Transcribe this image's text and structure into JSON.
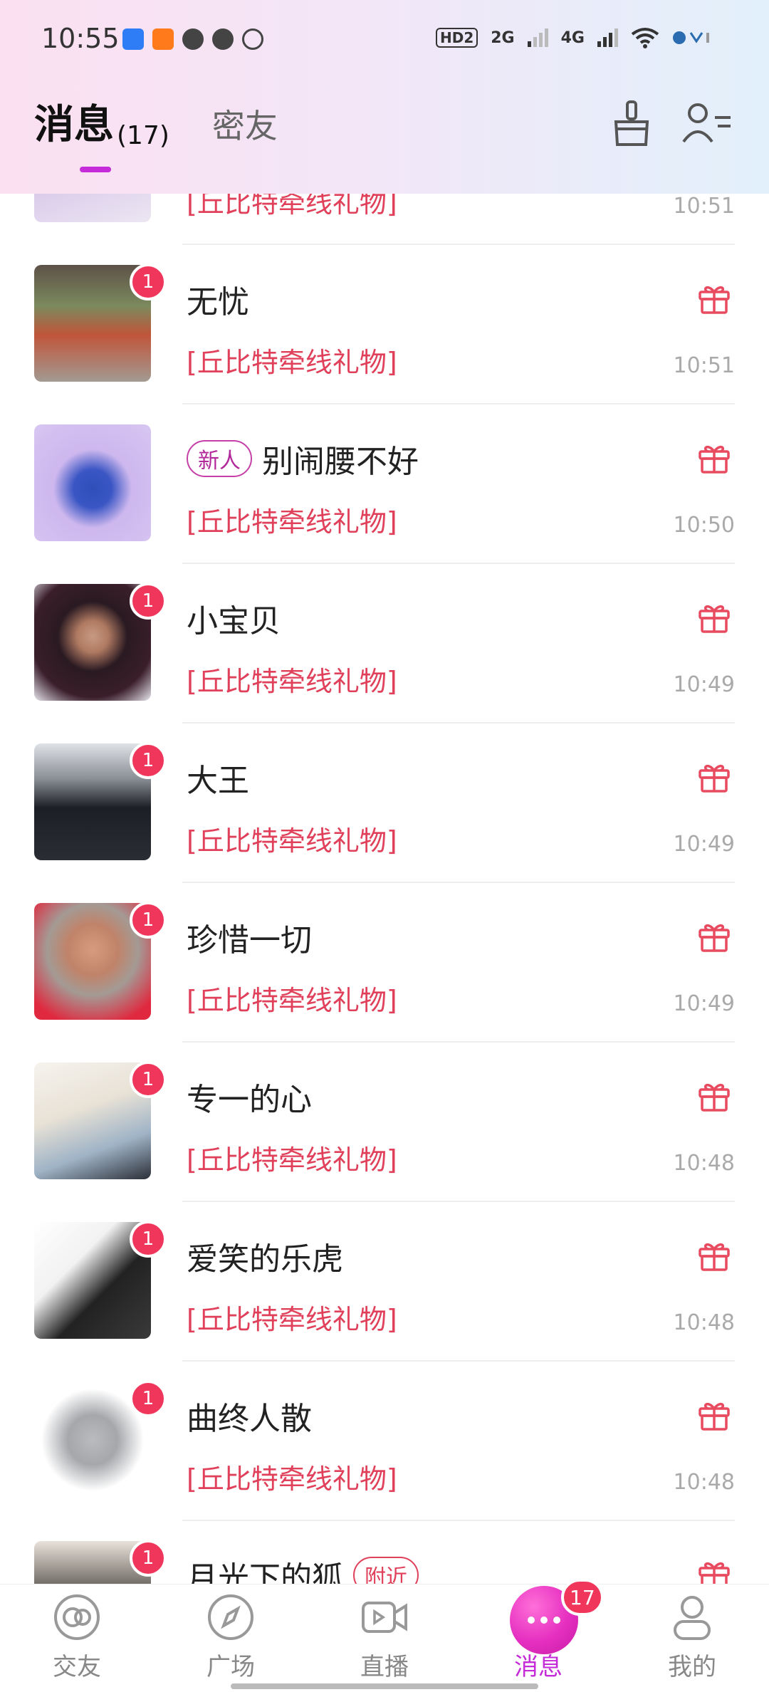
{
  "status_bar": {
    "time": "10:55",
    "hd": "HD2",
    "net1": "2G",
    "net2": "4G"
  },
  "header": {
    "tab_active": "消息",
    "tab_active_count": "(17)",
    "tab_other": "密友"
  },
  "colors": {
    "accent": "#c52bd8",
    "badge": "#f0365b",
    "preview_red": "#e0405a"
  },
  "messages": [
    {
      "name": "",
      "preview": "[丘比特牵线礼物]",
      "time": "10:51",
      "badge": "",
      "tag": ""
    },
    {
      "name": "无忧",
      "preview": "[丘比特牵线礼物]",
      "time": "10:51",
      "badge": "1",
      "tag": ""
    },
    {
      "name": "别闹腰不好",
      "preview": "[丘比特牵线礼物]",
      "time": "10:50",
      "badge": "",
      "tag": "新人"
    },
    {
      "name": "小宝贝",
      "preview": "[丘比特牵线礼物]",
      "time": "10:49",
      "badge": "1",
      "tag": ""
    },
    {
      "name": "大王",
      "preview": "[丘比特牵线礼物]",
      "time": "10:49",
      "badge": "1",
      "tag": ""
    },
    {
      "name": "珍惜一切",
      "preview": "[丘比特牵线礼物]",
      "time": "10:49",
      "badge": "1",
      "tag": ""
    },
    {
      "name": "专一的心",
      "preview": "[丘比特牵线礼物]",
      "time": "10:48",
      "badge": "1",
      "tag": ""
    },
    {
      "name": "爱笑的乐虎",
      "preview": "[丘比特牵线礼物]",
      "time": "10:48",
      "badge": "1",
      "tag": ""
    },
    {
      "name": "曲终人散",
      "preview": "[丘比特牵线礼物]",
      "time": "10:48",
      "badge": "1",
      "tag": ""
    },
    {
      "name": "月光下的狐",
      "preview": "",
      "time": "",
      "badge": "1",
      "tag": "附近"
    }
  ],
  "nav": {
    "items": [
      {
        "label": "交友"
      },
      {
        "label": "广场"
      },
      {
        "label": "直播"
      },
      {
        "label": "消息",
        "badge": "17"
      },
      {
        "label": "我的"
      }
    ]
  }
}
